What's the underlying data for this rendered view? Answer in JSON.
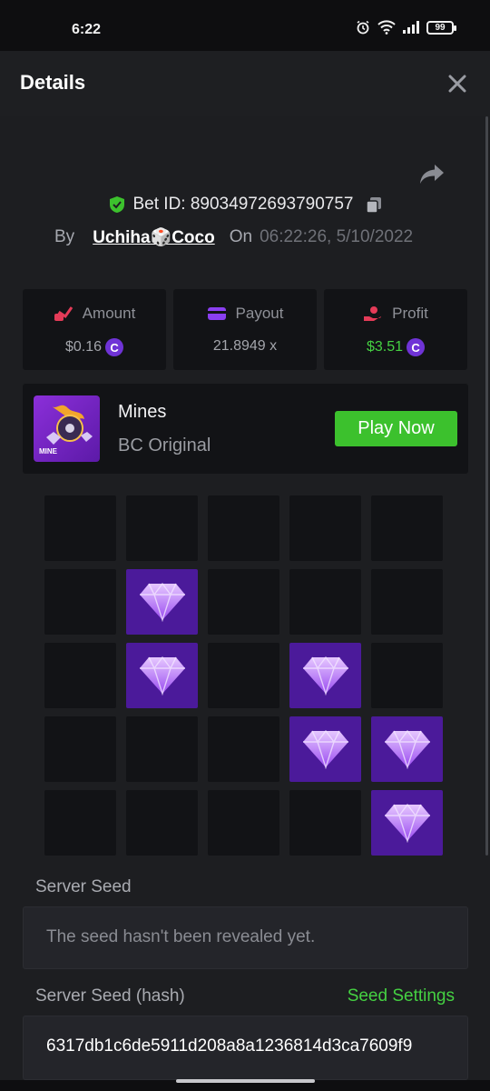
{
  "status_bar": {
    "time": "6:22",
    "battery": "99"
  },
  "header": {
    "title": "Details"
  },
  "bet": {
    "id_label": "Bet ID: 89034972693790757",
    "by_label": "By",
    "username": "Uchiha🎲Coco",
    "on_label": "On",
    "datetime": "06:22:26, 5/10/2022"
  },
  "stats": {
    "amount": {
      "label": "Amount",
      "value": "$0.16"
    },
    "payout": {
      "label": "Payout",
      "value": "21.8949 x"
    },
    "profit": {
      "label": "Profit",
      "value": "$3.51"
    }
  },
  "coin_symbol": "C",
  "game": {
    "name": "Mines",
    "provider": "BC Original",
    "thumb_tag": "MINE",
    "play_label": "Play Now"
  },
  "mines_grid": [
    [
      0,
      0,
      0,
      0,
      0
    ],
    [
      0,
      1,
      0,
      0,
      0
    ],
    [
      0,
      1,
      0,
      1,
      0
    ],
    [
      0,
      0,
      0,
      1,
      1
    ],
    [
      0,
      0,
      0,
      0,
      1
    ]
  ],
  "server_seed": {
    "label": "Server Seed",
    "value": "The seed hasn't been revealed yet."
  },
  "server_seed_hash": {
    "label": "Server Seed (hash)",
    "settings_label": "Seed Settings",
    "value": "6317db1c6de5911d208a8a1236814d3ca7609f9"
  },
  "colors": {
    "accent_green": "#3cc12d",
    "gem_tile": "#4b1a9a",
    "profit_green": "#45d142"
  }
}
